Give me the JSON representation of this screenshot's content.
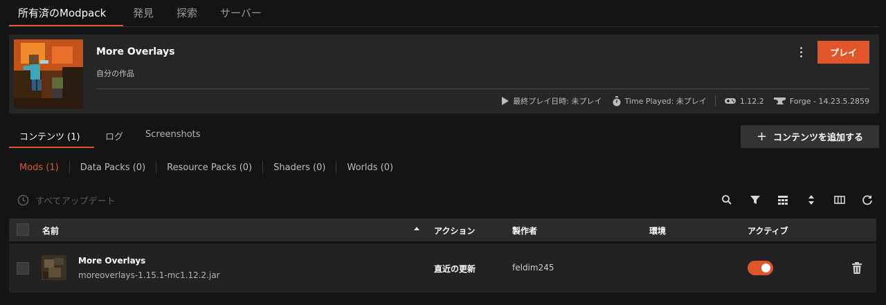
{
  "top_tabs": [
    "所有済のModpack",
    "発見",
    "探索",
    "サーバー"
  ],
  "pack": {
    "title": "More Overlays",
    "subtitle": "自分の作品",
    "menu_icon": "kebab-menu-icon",
    "play_label": "プレイ",
    "meta": {
      "last_played": "最終プレイ日時: 未プレイ",
      "time_played": "Time Played: 未プレイ",
      "mc_version": "1.12.2",
      "loader": "Forge - 14.23.5.2859"
    }
  },
  "content_tabs": [
    "コンテンツ (1)",
    "ログ",
    "Screenshots"
  ],
  "add_content_label": "コンテンツを追加する",
  "sub_tabs": [
    "Mods (1)",
    "Data Packs (0)",
    "Resource Packs (0)",
    "Shaders (0)",
    "Worlds (0)"
  ],
  "update_all_label": "すべてアップデート",
  "toolbar_icons": [
    "search-icon",
    "filter-icon",
    "group-icon",
    "sort-icon",
    "columns-icon",
    "refresh-icon"
  ],
  "table": {
    "headers": {
      "name": "名前",
      "action": "アクション",
      "author": "製作者",
      "env": "環境",
      "active": "アクティブ"
    },
    "rows": [
      {
        "name": "More Overlays",
        "file": "moreoverlays-1.15.1-mc1.12.2.jar",
        "action": "直近の更新",
        "author": "feldim245",
        "env": "",
        "active": true
      }
    ]
  },
  "colors": {
    "accent": "#e0562a",
    "background": "#141414",
    "card": "#262626"
  }
}
